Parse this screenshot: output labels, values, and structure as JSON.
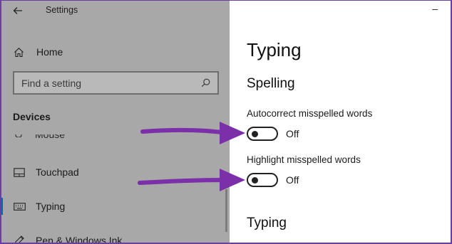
{
  "window": {
    "title": "Settings",
    "back_icon": "arrow-left-icon",
    "minimize_label": "–"
  },
  "sidebar": {
    "home_label": "Home",
    "search": {
      "placeholder": "Find a setting"
    },
    "section_header": "Devices",
    "partial_item_label": "Mouse",
    "items": [
      {
        "label": "Touchpad",
        "icon": "touchpad-icon",
        "active": false
      },
      {
        "label": "Typing",
        "icon": "keyboard-icon",
        "active": true
      },
      {
        "label": "Pen & Windows Ink",
        "icon": "pen-icon",
        "active": false
      }
    ]
  },
  "main": {
    "title": "Typing",
    "spelling_header": "Spelling",
    "settings": [
      {
        "label": "Autocorrect misspelled words",
        "state": "Off"
      },
      {
        "label": "Highlight misspelled words",
        "state": "Off"
      }
    ],
    "typing_header": "Typing"
  },
  "colors": {
    "sidebar_bg": "#a8a8a8",
    "accent": "#0067c0",
    "annotation_arrow": "#7b2fa8",
    "frame": "#6a3fa0"
  }
}
